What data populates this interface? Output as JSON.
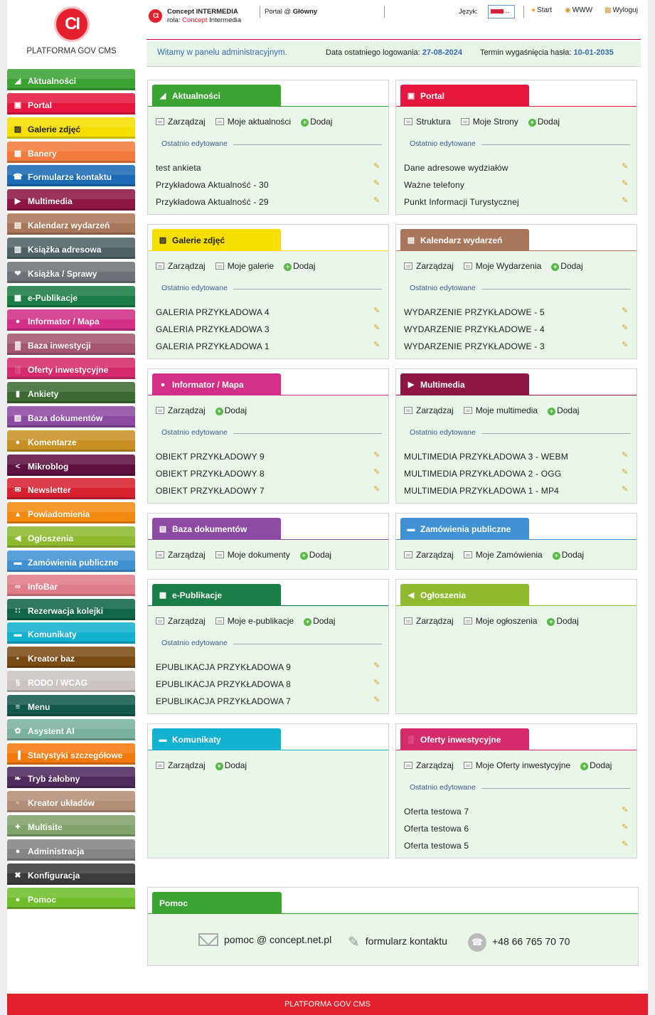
{
  "logo": {
    "initials": "CI",
    "title": "PLATFORMA GOV CMS"
  },
  "header": {
    "company": "Concept INTERMEDIA",
    "role_prefix": "rola: ",
    "role_red": "Concept",
    "role_rest": " Intermedia",
    "portal_prefix": "Portal @ ",
    "portal_name": "Główny",
    "lang_label": "Język:",
    "lang_dots": "...",
    "links": {
      "start": "Start",
      "www": "WWW",
      "logout": "Wyloguj"
    }
  },
  "welcome": {
    "text": "Witamy w panelu administracyjnym.",
    "last_login_label": "Data ostatniego logowania: ",
    "last_login_value": "27-08-2024",
    "pass_exp_label": "Termin wygaśnięcia hasła: ",
    "pass_exp_value": "10-01-2035"
  },
  "sidebar": [
    {
      "label": "Aktualności",
      "icon": "rss-icon",
      "color": "#3ba332"
    },
    {
      "label": "Portal",
      "icon": "window-icon",
      "color": "#e5173f"
    },
    {
      "label": "Galerie zdjęć",
      "icon": "image-icon",
      "color": "#f6de00",
      "dark": true
    },
    {
      "label": "Banery",
      "icon": "banner-icon",
      "color": "#f47b3b"
    },
    {
      "label": "Formularze kontaktu",
      "icon": "phone-icon",
      "color": "#1b6ab5"
    },
    {
      "label": "Multimedia",
      "icon": "play-icon",
      "color": "#8d1645"
    },
    {
      "label": "Kalendarz wydarzeń",
      "icon": "calendar-icon",
      "color": "#a97659"
    },
    {
      "label": "Książka adresowa",
      "icon": "address-book-icon",
      "color": "#4f6165"
    },
    {
      "label": "Książka / Sprawy",
      "icon": "handshake-icon",
      "color": "#6d7378"
    },
    {
      "label": "e-Publikacje",
      "icon": "book-icon",
      "color": "#1a7c47"
    },
    {
      "label": "Informator / Mapa",
      "icon": "map-pin-icon",
      "color": "#d32f86"
    },
    {
      "label": "Baza inwestycji",
      "icon": "chart-icon",
      "color": "#a6566e"
    },
    {
      "label": "Oferty inwestycyjne",
      "icon": "offer-icon",
      "color": "#d52a6b"
    },
    {
      "label": "Ankiety",
      "icon": "survey-icon",
      "color": "#3d6a33"
    },
    {
      "label": "Baza dokumentów",
      "icon": "documents-icon",
      "color": "#8c4aa3"
    },
    {
      "label": "Komentarze",
      "icon": "comment-icon",
      "color": "#c99125"
    },
    {
      "label": "Mikroblog",
      "icon": "share-icon",
      "color": "#5e103f"
    },
    {
      "label": "Newsletter",
      "icon": "envelope-icon",
      "color": "#d8212f"
    },
    {
      "label": "Powiadomienia",
      "icon": "bell-icon",
      "color": "#f28a10"
    },
    {
      "label": "Ogłoszenia",
      "icon": "megaphone-icon",
      "color": "#8fb92e"
    },
    {
      "label": "Zamówienia publiczne",
      "icon": "bed-icon",
      "color": "#4191d5",
      "dark_text": true
    },
    {
      "label": "InfoBar",
      "icon": "glasses-icon",
      "color": "#e07d8a"
    },
    {
      "label": "Rezerwacja kolejki",
      "icon": "queue-icon",
      "color": "#116647"
    },
    {
      "label": "Komunikaty",
      "icon": "chat-icon",
      "color": "#13b1d0"
    },
    {
      "label": "Kreator baz",
      "icon": "database-icon",
      "color": "#7b4b14"
    },
    {
      "label": "RODO / WCAG",
      "icon": "section-icon",
      "color": "#cbc4c3"
    },
    {
      "label": "Menu",
      "icon": "menu-icon",
      "color": "#145a4c"
    },
    {
      "label": "Asystent AI",
      "icon": "ai-icon",
      "color": "#7ab19f"
    },
    {
      "label": "Statystyki szczegółowe",
      "icon": "stats-icon",
      "color": "#f5780b"
    },
    {
      "label": "Tryb żałobny",
      "icon": "ribbon-icon",
      "color": "#4e2a5d"
    },
    {
      "label": "Kreator układów",
      "icon": "layout-icon",
      "color": "#b38f79"
    },
    {
      "label": "Multisite",
      "icon": "network-icon",
      "color": "#82a36c"
    },
    {
      "label": "Administracja",
      "icon": "user-icon",
      "color": "#858585"
    },
    {
      "label": "Konfiguracja",
      "icon": "tools-icon",
      "color": "#3b3b3b"
    },
    {
      "label": "Pomoc",
      "icon": "bulb-icon",
      "color": "#6fbe2c"
    }
  ],
  "panels": [
    {
      "title": "Aktualności",
      "icon": "rss-icon",
      "color": "#3ba332",
      "actions": [
        "Zarządzaj",
        "Moje aktualności",
        "Dodaj"
      ],
      "recent_label": "Ostatnio edytowane",
      "items": [
        "test ankieta",
        "Przykładowa Aktualność - 30",
        "Przykładowa Aktualność - 29"
      ]
    },
    {
      "title": "Portal",
      "icon": "window-icon",
      "color": "#e5173f",
      "actions": [
        "Struktura",
        "Moje Strony",
        "Dodaj"
      ],
      "recent_label": "Ostatnio edytowane",
      "items": [
        "Dane adresowe wydziałów",
        "Ważne telefony",
        "Punkt Informacji Turystycznej"
      ]
    },
    {
      "title": "Galerie zdjęć",
      "icon": "image-icon",
      "color": "#f6de00",
      "dark": true,
      "actions": [
        "Zarządzaj",
        "Moje galerie",
        "Dodaj"
      ],
      "recent_label": "Ostatnio edytowane",
      "items": [
        "GALERIA PRZYKŁADOWA 4",
        "GALERIA PRZYKŁADOWA 3",
        "GALERIA PRZYKŁADOWA 1"
      ]
    },
    {
      "title": "Kalendarz wydarzeń",
      "icon": "calendar-icon",
      "color": "#a97659",
      "actions": [
        "Zarządzaj",
        "Moje Wydarzenia",
        "Dodaj"
      ],
      "recent_label": "Ostatnio edytowane",
      "items": [
        "WYDARZENIE PRZYKŁADOWE - 5",
        "WYDARZENIE PRZYKŁADOWE - 4",
        "WYDARZENIE PRZYKŁADOWE - 3"
      ]
    },
    {
      "title": "Informator / Mapa",
      "icon": "map-pin-icon",
      "color": "#d32f86",
      "actions": [
        "Zarządzaj",
        "Dodaj"
      ],
      "recent_label": "Ostatnio edytowane",
      "items": [
        "OBIEKT PRZYKŁADOWY 9",
        "OBIEKT PRZYKŁADOWY 8",
        "OBIEKT PRZYKŁADOWY 7"
      ]
    },
    {
      "title": "Multimedia",
      "icon": "play-icon",
      "color": "#8d1645",
      "actions": [
        "Zarządzaj",
        "Moje multimedia",
        "Dodaj"
      ],
      "recent_label": "Ostatnio edytowane",
      "items": [
        "MULTIMEDIA PRZYKŁADOWA 3 - WEBM",
        "MULTIMEDIA PRZYKŁADOWA 2 - OGG",
        "MULTIMEDIA PRZYKŁADOWA 1 - MP4"
      ]
    },
    {
      "title": "Baza dokumentów",
      "icon": "documents-icon",
      "color": "#8c4aa3",
      "actions": [
        "Zarządzaj",
        "Moje dokumenty",
        "Dodaj"
      ]
    },
    {
      "title": "Zamówienia publiczne",
      "icon": "bed-icon",
      "color": "#4191d5",
      "actions": [
        "Zarządzaj",
        "Moje Zamówienia",
        "Dodaj"
      ]
    },
    {
      "title": "e-Publikacje",
      "icon": "book-icon",
      "color": "#1a7c47",
      "actions": [
        "Zarządzaj",
        "Moje e-publikacje",
        "Dodaj"
      ],
      "recent_label": "Ostatnio edytowane",
      "items": [
        "EPUBLIKACJA PRZYKŁADOWA 9",
        "EPUBLIKACJA PRZYKŁADOWA 8",
        "EPUBLIKACJA PRZYKŁADOWA 7"
      ]
    },
    {
      "title": "Ogłoszenia",
      "icon": "megaphone-icon",
      "color": "#8fb92e",
      "actions": [
        "Zarządzaj",
        "Moje ogłoszenia",
        "Dodaj"
      ]
    },
    {
      "title": "Komunikaty",
      "icon": "chat-icon",
      "color": "#13b1d0",
      "actions": [
        "Zarządzaj",
        "Dodaj"
      ]
    },
    {
      "title": "Oferty inwestycyjne",
      "icon": "offer-icon",
      "color": "#d52a6b",
      "actions": [
        "Zarządzaj",
        "Moje Oferty inwestycyjne",
        "Dodaj"
      ],
      "recent_label": "Ostatnio edytowane",
      "items": [
        "Oferta testowa 7",
        "Oferta testowa 6",
        "Oferta testowa 5"
      ]
    }
  ],
  "help": {
    "title": "Pomoc",
    "color": "#3ba332",
    "email": "pomoc @ concept.net.pl",
    "form": "formularz kontaktu",
    "phone": "+48 66 765 70 70"
  },
  "footer": "PLATFORMA GOV CMS"
}
